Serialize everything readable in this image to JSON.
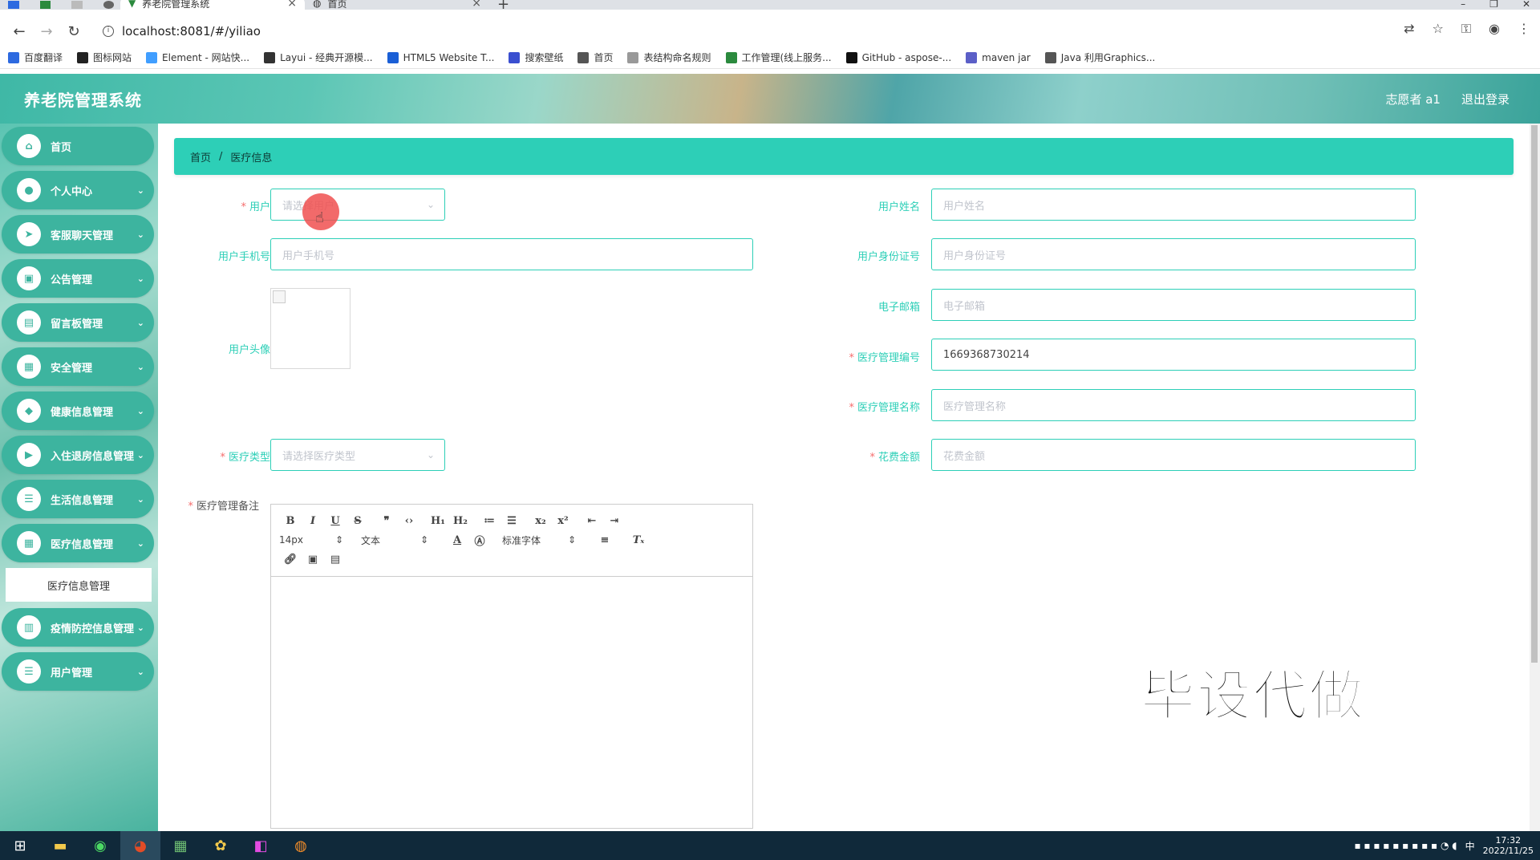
{
  "browser": {
    "tabs": [
      {
        "title": "养老院管理系统",
        "active": true
      },
      {
        "title": "首页",
        "active": false
      }
    ],
    "new_tab": "+",
    "url": "localhost:8081/#/yiliao",
    "bookmarks": [
      {
        "label": "百度翻译",
        "color": "#2d6ae0"
      },
      {
        "label": "图标网站",
        "color": "#222222"
      },
      {
        "label": "Element - 网站快...",
        "color": "#409eff"
      },
      {
        "label": "Layui - 经典开源模...",
        "color": "#333333"
      },
      {
        "label": "HTML5 Website T...",
        "color": "#1a5fd6"
      },
      {
        "label": "搜索壁纸",
        "color": "#3a4fd0"
      },
      {
        "label": "首页",
        "color": "#555555"
      },
      {
        "label": "表结构命名规则",
        "color": "#999999"
      },
      {
        "label": "工作管理(线上服务...",
        "color": "#2b8a3e"
      },
      {
        "label": "GitHub - aspose-...",
        "color": "#111111"
      },
      {
        "label": "maven jar",
        "color": "#5b5fc7"
      },
      {
        "label": "Java 利用Graphics...",
        "color": "#555555"
      }
    ]
  },
  "header": {
    "title": "养老院管理系统",
    "user": "志愿者 a1",
    "logout": "退出登录"
  },
  "sidebar": {
    "items": [
      {
        "label": "首页",
        "icon": "home-icon",
        "glyph": "⌂",
        "expandable": false
      },
      {
        "label": "个人中心",
        "icon": "user-icon",
        "glyph": "●",
        "expandable": true
      },
      {
        "label": "客服聊天管理",
        "icon": "send-icon",
        "glyph": "➤",
        "expandable": true
      },
      {
        "label": "公告管理",
        "icon": "briefcase-icon",
        "glyph": "▣",
        "expandable": true
      },
      {
        "label": "留言板管理",
        "icon": "document-icon",
        "glyph": "▤",
        "expandable": true
      },
      {
        "label": "安全管理",
        "icon": "grid-icon",
        "glyph": "▦",
        "expandable": true
      },
      {
        "label": "健康信息管理",
        "icon": "location-icon",
        "glyph": "◆",
        "expandable": true
      },
      {
        "label": "入住退房信息管理",
        "icon": "video-icon",
        "glyph": "▶",
        "expandable": true
      },
      {
        "label": "生活信息管理",
        "icon": "list-icon",
        "glyph": "☰",
        "expandable": true
      },
      {
        "label": "医疗信息管理",
        "icon": "grid-icon",
        "glyph": "▦",
        "expandable": true
      }
    ],
    "active_sub": "医疗信息管理",
    "items_after": [
      {
        "label": "疫情防控信息管理",
        "icon": "book-icon",
        "glyph": "▥",
        "expandable": true
      },
      {
        "label": "用户管理",
        "icon": "menu-icon",
        "glyph": "☰",
        "expandable": true
      }
    ]
  },
  "breadcrumb": {
    "home": "首页",
    "separator": "/",
    "current": "医疗信息"
  },
  "form": {
    "user_label": "用户",
    "user_placeholder": "请选择用户",
    "user_name_label": "用户姓名",
    "user_name_placeholder": "用户姓名",
    "phone_label": "用户手机号",
    "phone_placeholder": "用户手机号",
    "id_label": "用户身份证号",
    "id_placeholder": "用户身份证号",
    "avatar_label": "用户头像",
    "email_label": "电子邮箱",
    "email_placeholder": "电子邮箱",
    "code_label": "医疗管理编号",
    "code_value": "1669368730214",
    "name_label": "医疗管理名称",
    "name_placeholder": "医疗管理名称",
    "type_label": "医疗类型",
    "type_placeholder": "请选择医疗类型",
    "cost_label": "花费金额",
    "cost_placeholder": "花费金额",
    "remark_label": "医疗管理备注",
    "required_mark": "*"
  },
  "editor": {
    "font_size": "14px",
    "text_type": "文本",
    "font_family": "标准字体"
  },
  "watermark": "毕设代做",
  "taskbar": {
    "time": "17:32",
    "date": "2022/11/25",
    "ime": "中"
  }
}
